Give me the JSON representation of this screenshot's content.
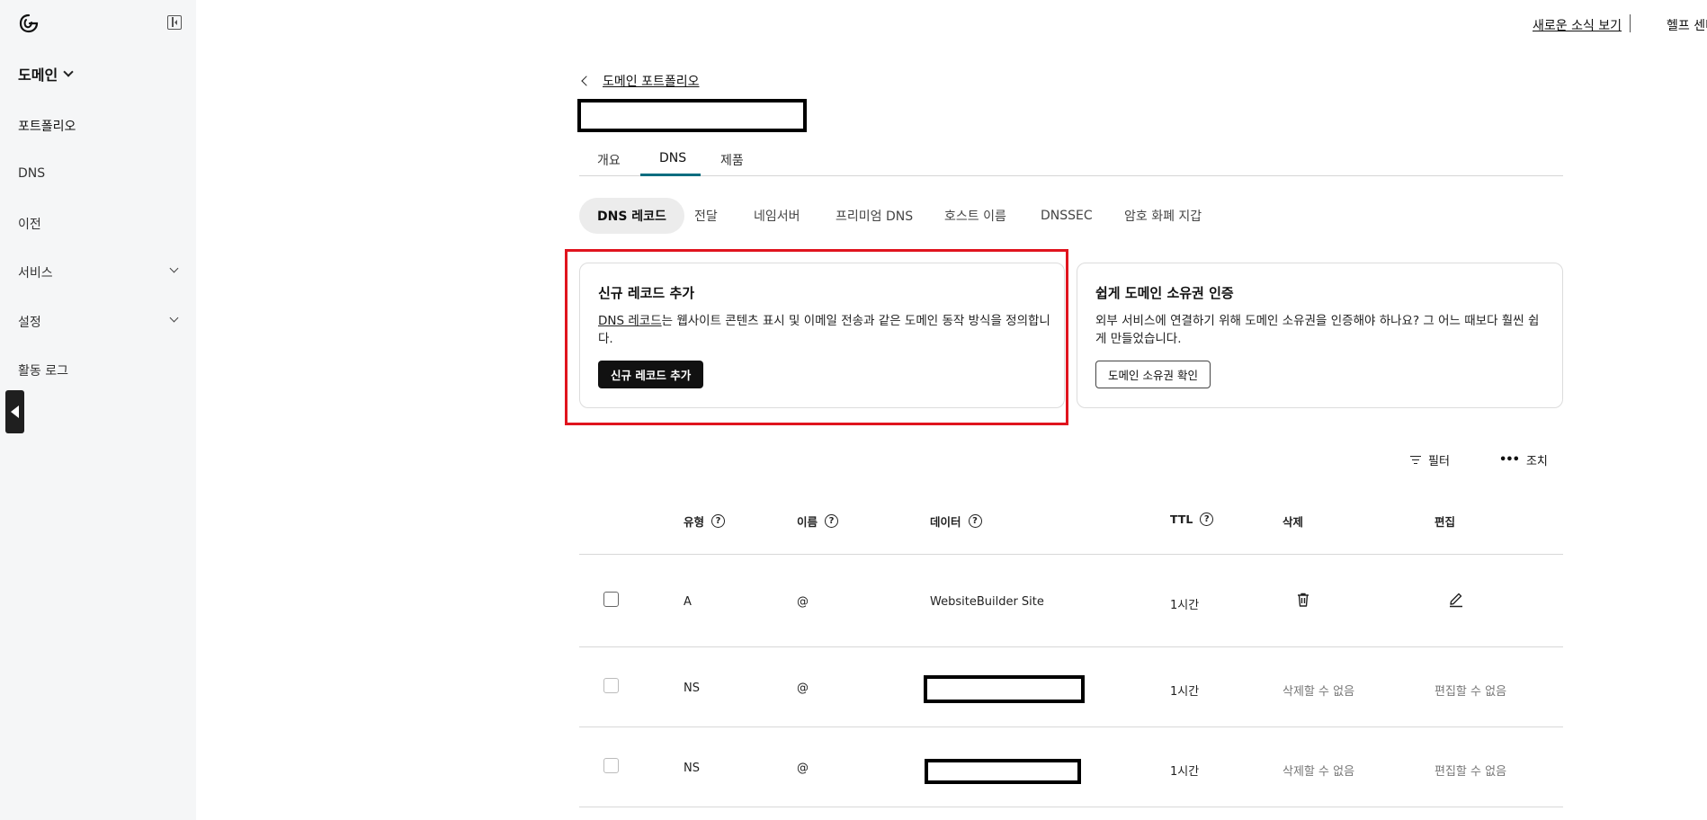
{
  "sidebar": {
    "domain_label": "도메인",
    "items": [
      {
        "label": "포트폴리오"
      },
      {
        "label": "DNS"
      },
      {
        "label": "이전"
      },
      {
        "label": "서비스"
      },
      {
        "label": "설정"
      },
      {
        "label": "활동 로그"
      }
    ]
  },
  "header": {
    "whats_new": "새로운 소식 보기",
    "help": "헬프 센터"
  },
  "breadcrumb": {
    "back_label": "도메인 포트폴리오"
  },
  "tabs": [
    {
      "label": "개요"
    },
    {
      "label": "DNS"
    },
    {
      "label": "제품"
    }
  ],
  "subtabs": [
    {
      "label": "DNS 레코드"
    },
    {
      "label": "전달"
    },
    {
      "label": "네임서버"
    },
    {
      "label": "프리미엄 DNS"
    },
    {
      "label": "호스트 이름"
    },
    {
      "label": "DNSSEC"
    },
    {
      "label": "암호 화폐 지갑"
    }
  ],
  "cards": {
    "add_record": {
      "title": "신규 레코드 추가",
      "link_text": "DNS 레코드",
      "desc_rest": "는 웹사이트 콘텐츠 표시 및 이메일 전송과 같은 도메인 동작 방식을 정의합니",
      "desc_line2": "다.",
      "button": "신규 레코드 추가"
    },
    "verify": {
      "title": "쉽게 도메인 소유권 인증",
      "desc_line1": "외부 서비스에 연결하기 위해 도메인 소유권을 인증해야 하나요? 그 어느 때보다 훨씬 쉽",
      "desc_line2": "게 만들었습니다.",
      "button": "도메인 소유권 확인"
    }
  },
  "toolbar": {
    "filter": "필터",
    "actions": "조치"
  },
  "table": {
    "columns": {
      "type": "유형",
      "name": "이름",
      "data": "데이터",
      "ttl": "TTL",
      "delete": "삭제",
      "edit": "편집"
    },
    "help_glyph": "?",
    "rows": [
      {
        "type": "A",
        "name": "@",
        "data": "WebsiteBuilder Site",
        "ttl": "1시간",
        "delete": "",
        "edit": ""
      },
      {
        "type": "NS",
        "name": "@",
        "data": "",
        "ttl": "1시간",
        "delete": "삭제할 수 없음",
        "edit": "편집할 수 없음"
      },
      {
        "type": "NS",
        "name": "@",
        "data": "",
        "ttl": "1시간",
        "delete": "삭제할 수 없음",
        "edit": "편집할 수 없음"
      }
    ]
  },
  "colors": {
    "accent_teal": "#0a6d80",
    "highlight_red": "#e0141e",
    "sidebar_bg": "#f5f6f7"
  }
}
